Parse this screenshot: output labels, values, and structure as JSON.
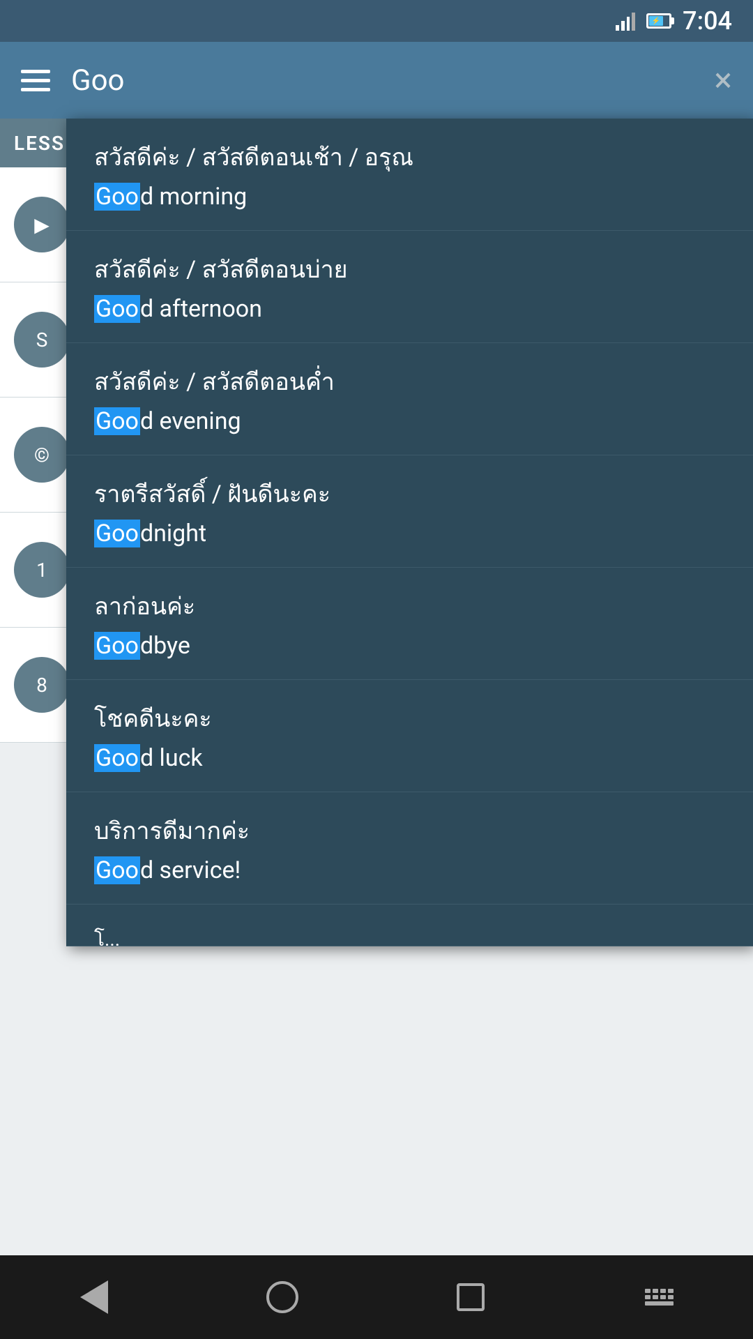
{
  "statusBar": {
    "time": "7:04"
  },
  "toolbar": {
    "searchText": "Goo",
    "closeLabel": "×",
    "hamburgerAriaLabel": "Menu"
  },
  "background": {
    "lessonsLabel": "LESS"
  },
  "dropdown": {
    "items": [
      {
        "thai": "สวัสดีค่ะ / สวัสดีตอนเช้า / อรุณ",
        "english_prefix": "",
        "highlight": "Goo",
        "english_rest": "d morning"
      },
      {
        "thai": "สวัสดีค่ะ / สวัสดีตอนบ่าย",
        "highlight": "Goo",
        "english_rest": "d afternoon"
      },
      {
        "thai": "สวัสดีค่ะ / สวัสดีตอนค่ำ",
        "highlight": "Goo",
        "english_rest": "d evening"
      },
      {
        "thai": "ราตรีสวัสดิ์ / ฝันดีนะคะ",
        "highlight": "Goo",
        "english_rest": "dnight"
      },
      {
        "thai": "ลาก่อนค่ะ",
        "highlight": "Goo",
        "english_rest": "dbye"
      },
      {
        "thai": "โชคดีนะคะ",
        "highlight": "Goo",
        "english_rest": "d luck"
      },
      {
        "thai": "บริการดีมากค่ะ",
        "highlight": "Goo",
        "english_rest": "d service!"
      }
    ]
  }
}
